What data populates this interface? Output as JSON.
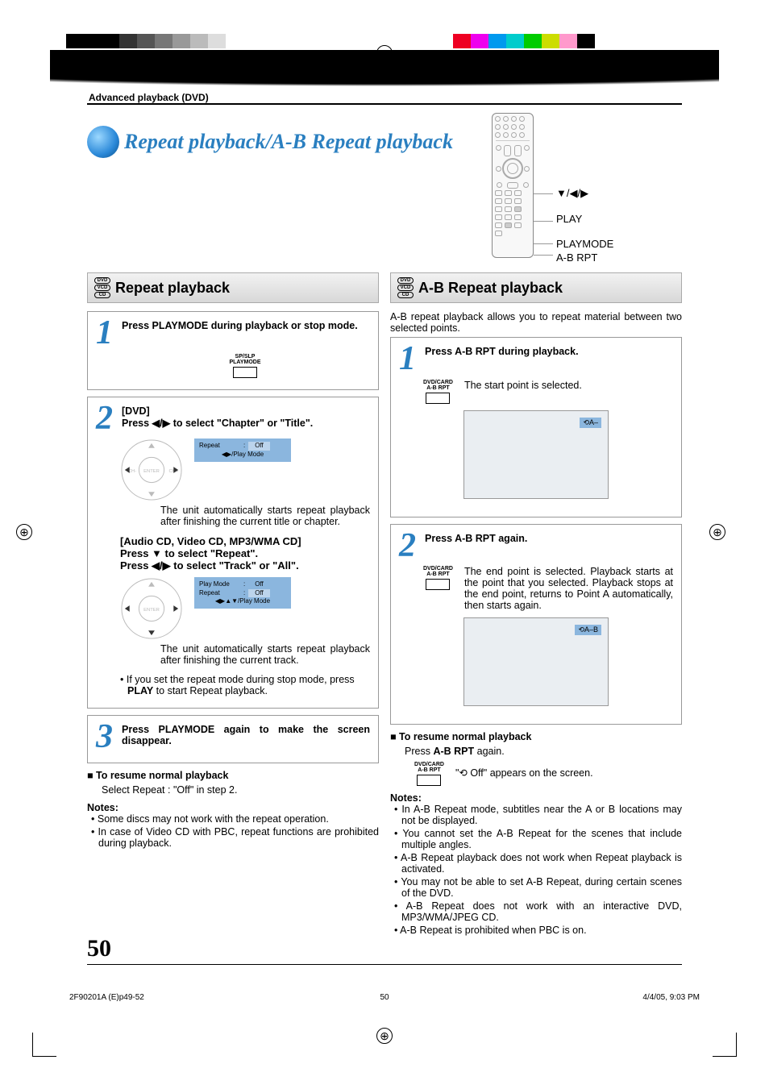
{
  "section_label": "Advanced playback (DVD)",
  "page_title": "Repeat playback/A-B Repeat playback",
  "remote_labels": {
    "nav": "▼/◀/▶",
    "play": "PLAY",
    "playmode": "PLAYMODE",
    "abrpt": "A-B RPT"
  },
  "left": {
    "heading": "Repeat playback",
    "step1": {
      "text": "Press PLAYMODE during playback or stop mode.",
      "btn_top": "SP/SLP",
      "btn_bot": "PLAYMODE"
    },
    "step2": {
      "dvd_label": "[DVD]",
      "line1": "Press ◀/▶ to select \"Chapter\" or \"Title\".",
      "osd1_k": "Repeat",
      "osd1_sep": ":",
      "osd1_v": "Off",
      "osd1_nav": "◀▶/Play Mode",
      "para1": "The unit automatically starts repeat playback after finishing the current title or chapter.",
      "audio_label": "[Audio CD, Video CD, MP3/WMA CD]",
      "line2": "Press ▼ to select \"Repeat\".",
      "line3": "Press ◀/▶ to select \"Track\" or \"All\".",
      "osd2_k1": "Play Mode",
      "osd2_v1": "Off",
      "osd2_k2": "Repeat",
      "osd2_v2": "Off",
      "osd2_nav": "◀▶▲▼/Play Mode",
      "para2": "The unit automatically starts repeat playback after finishing the current track.",
      "bullet1a": "If you set the repeat mode during stop mode, press ",
      "bullet1b": "PLAY",
      "bullet1c": " to start Repeat playback."
    },
    "step3": {
      "text": "Press PLAYMODE again to make the screen disappear."
    },
    "resume_h": "To resume normal playback",
    "resume_t": "Select Repeat : \"Off\" in step 2.",
    "notes_h": "Notes:",
    "notes": [
      "Some discs may not work with the repeat operation.",
      "In case of Video CD with PBC, repeat functions are prohibited during playback."
    ]
  },
  "right": {
    "heading": "A-B Repeat playback",
    "intro": "A-B repeat playback allows you to repeat material between two selected points.",
    "step1": {
      "text": "Press A-B RPT during playback.",
      "btn_top": "DVD/CARD",
      "btn_bot": "A-B RPT",
      "sub": "The start point is selected.",
      "badge": "⟲A–"
    },
    "step2": {
      "text": "Press A-B RPT again.",
      "btn_top": "DVD/CARD",
      "btn_bot": "A-B RPT",
      "para": "The end point is selected. Playback starts at the point that you selected. Playback stops at the end point, returns to Point A automatically, then starts again.",
      "badge": "⟲A–B"
    },
    "resume_h": "To resume normal playback",
    "resume_t1": "Press ",
    "resume_t2": "A-B RPT",
    "resume_t3": " again.",
    "off_btn_top": "DVD/CARD",
    "off_btn_bot": "A-B RPT",
    "off_msg1": "\"",
    "off_msg_icon": "⟲ Off",
    "off_msg2": "\" appears on the screen.",
    "notes_h": "Notes:",
    "notes": [
      "In A-B Repeat mode, subtitles near the A or B locations may not be displayed.",
      "You cannot set the A-B Repeat for the scenes that include multiple angles.",
      "A-B Repeat playback does not work when Repeat playback is activated.",
      "You may not be able to set A-B Repeat, during certain scenes of the DVD.",
      "A-B Repeat does not work with an interactive DVD, MP3/WMA/JPEG CD.",
      "A-B Repeat is prohibited when PBC is on."
    ]
  },
  "page_number": "50",
  "footer": {
    "left": "2F90201A (E)p49-52",
    "center": "50",
    "right": "4/4/05, 9:03 PM"
  },
  "disc_tags": [
    "DVD",
    "VCD",
    "CD"
  ]
}
